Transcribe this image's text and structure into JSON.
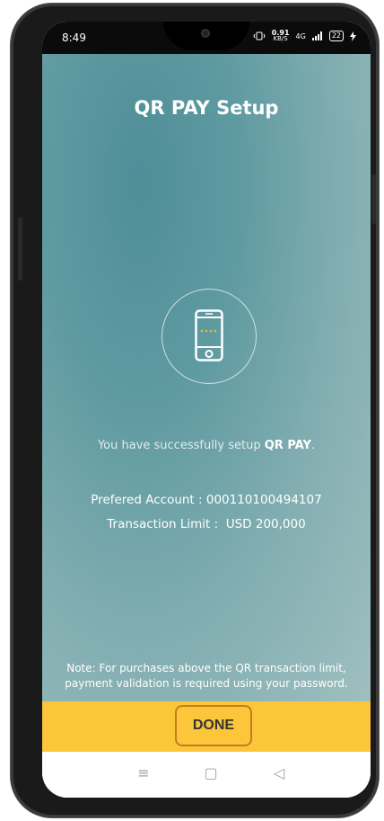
{
  "status_bar": {
    "time": "8:49",
    "speed_value": "0.91",
    "speed_unit": "KB/S",
    "network": "4G",
    "battery": "22"
  },
  "header": {
    "title": "QR PAY Setup"
  },
  "main": {
    "success_prefix": "You have successfully setup ",
    "success_highlight": "QR PAY",
    "success_suffix": ".",
    "preferred_account": "Prefered Account : 000110100494107",
    "transaction_limit_label": "Transaction Limit :",
    "transaction_limit_value": "USD 200,000",
    "note": "Note: For purchases above the QR transaction limit, payment validation is required using your password."
  },
  "footer": {
    "done_label": "DONE"
  },
  "navbar": {
    "menu_icon": "≡",
    "home_icon": "▢",
    "back_icon": "◁"
  },
  "colors": {
    "accent": "#fcc63b",
    "highlight_border": "#c77a1e",
    "background_teal": "#5f9aa1"
  }
}
